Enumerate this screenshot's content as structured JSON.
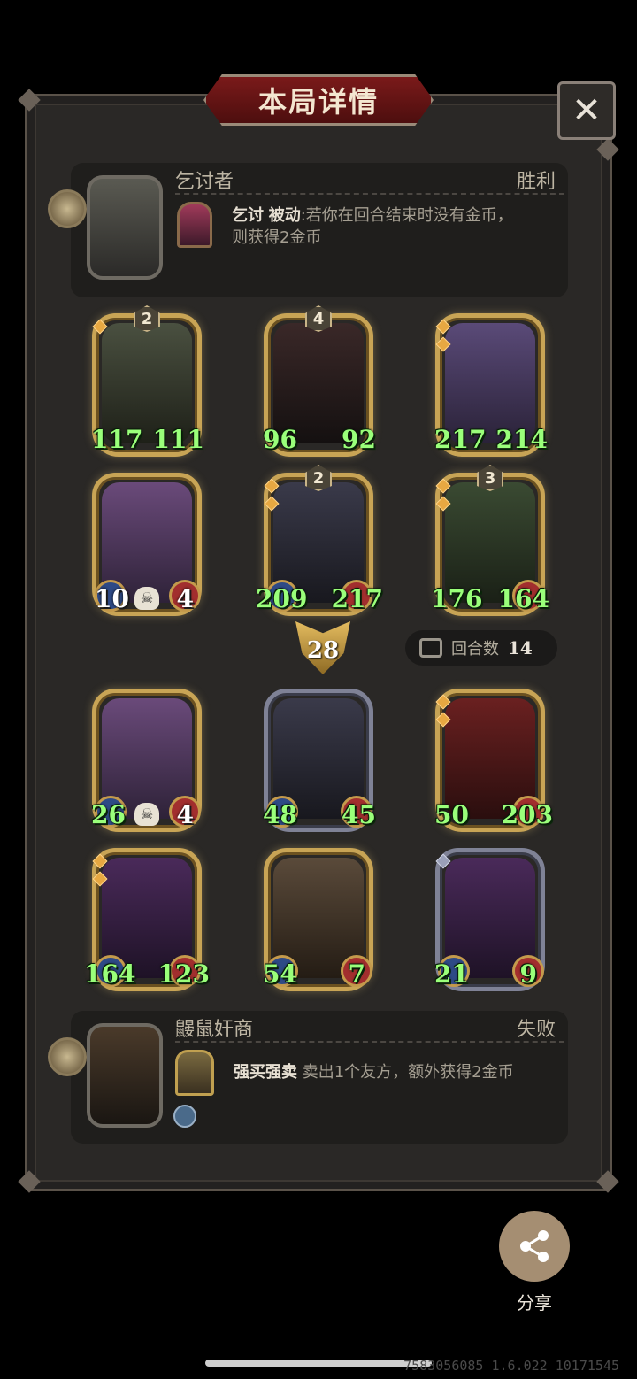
{
  "header": {
    "title": "本局详情",
    "close_icon": "✕"
  },
  "top_player": {
    "name": "乞讨者",
    "result": "胜利",
    "skill_name": "乞讨",
    "skill_type": "被动",
    "skill_desc_line1": ":若你在回合结束时没有金币，",
    "skill_desc_line2": "则获得2金币"
  },
  "top_units": [
    {
      "star": "2",
      "attack": "117",
      "health": "111",
      "color": "#4a5040"
    },
    {
      "star": "4",
      "attack": "96",
      "health": "92",
      "color": "#3a2828"
    },
    {
      "star": "",
      "attack": "217",
      "health": "214",
      "color": "#5a4a78"
    },
    {
      "star": "",
      "attack": "10",
      "health": "4",
      "color": "#6a4a7a"
    },
    {
      "star": "2",
      "attack": "209",
      "health": "217",
      "color": "#3a3a4a"
    },
    {
      "star": "3",
      "attack": "176",
      "health": "164",
      "color": "#3a4a32"
    }
  ],
  "middle": {
    "damage": "28",
    "rounds_label": "回合数",
    "rounds_value": "14"
  },
  "bottom_units": [
    {
      "attack": "26",
      "health": "4",
      "color": "#6a4a7a"
    },
    {
      "attack": "48",
      "health": "45",
      "color": "#3a3a4a"
    },
    {
      "attack": "50",
      "health": "203",
      "color": "#6a2020"
    },
    {
      "attack": "164",
      "health": "123",
      "color": "#4a2a5a"
    },
    {
      "attack": "54",
      "health": "7",
      "color": "#5a4a3a"
    },
    {
      "attack": "21",
      "health": "9",
      "color": "#4a2a5a"
    }
  ],
  "bottom_player": {
    "name": "鼹鼠奸商",
    "result": "失败",
    "skill_name": "强买强卖",
    "skill_desc": " 卖出1个友方，额外获得2金币"
  },
  "share": {
    "label": "分享"
  },
  "version": "7583056085 1.6.022 10171545"
}
